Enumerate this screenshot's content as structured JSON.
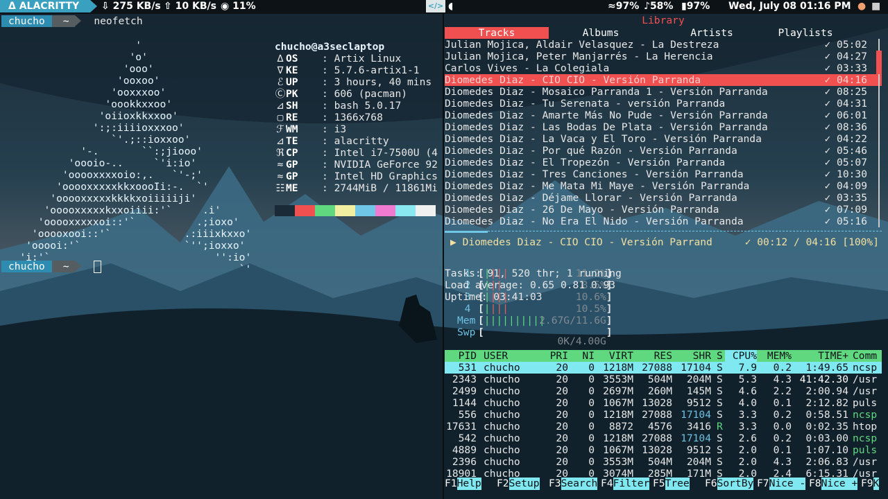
{
  "topbar": {
    "workspace": "ALACRITTY",
    "net_down": "275 KB/s",
    "net_up": "10 KB/s",
    "cpu": "11%",
    "wifi": "97%",
    "volume": "58%",
    "battery": "97%",
    "datetime": "Wed, July 08 01:16 PM"
  },
  "left_terminal": {
    "prompt_user": "chucho",
    "prompt_dir": "~",
    "command": "neofetch",
    "logo_lines": [
      "                      '",
      "                     'o'",
      "                    'ooo'",
      "                   'ooxoo'",
      "                  'ooxxxoo'",
      "                 'oookkxxoo'",
      "                'oiioxkkxxoo'",
      "               ':;:iiiioxxxoo'",
      "                  `'.;::ioxxoo'",
      "             '-.       ``:;jiooo'",
      "           'oooio-..     `'i:io'",
      "          'ooooxxxxoio:,.   `'-;'",
      "         'ooooxxxxxkkxoooIi:-.  `'",
      "        'ooooxxxxxkkkkxoiiiiiji'",
      "       'ooooxxxxxkxxoiiii:'`     .i'",
      "      'ooooxxxxxoi::'`          .;ioxo'",
      "     'ooooxooi::'`            .:iiixkxxo'",
      "    'ooooi:'`                 `'';ioxxo'",
      "   'i:'`                           '':io'",
      "  '`                                   `'"
    ],
    "info_header": "chucho@a3seclaptop",
    "info": [
      {
        "key": "OS",
        "value": "Artix Linux"
      },
      {
        "key": "KE",
        "value": "5.7.6-artix1-1"
      },
      {
        "key": "UP",
        "value": "3 hours, 40 mins"
      },
      {
        "key": "PK",
        "value": "606 (pacman)"
      },
      {
        "key": "SH",
        "value": "bash 5.0.17"
      },
      {
        "key": "RE",
        "value": "1366x768"
      },
      {
        "key": "WM",
        "value": "i3"
      },
      {
        "key": "TE",
        "value": "alacritty"
      },
      {
        "key": "CP",
        "value": "Intel i7-7500U (4"
      },
      {
        "key": "GP",
        "value": "NVIDIA GeForce 92"
      },
      {
        "key": "GP",
        "value": "Intel HD Graphics"
      },
      {
        "key": "ME",
        "value": "2744MiB / 11861Mi"
      }
    ],
    "swatch_colors": [
      "#1a2a36",
      "#f05050",
      "#5fd87f",
      "#f2f0a0",
      "#6fc6e6",
      "#f07ad0",
      "#8ae8f0",
      "#f0f0f0"
    ],
    "prompt2_user": "chucho",
    "prompt2_dir": "~"
  },
  "music": {
    "title": "Library",
    "tabs": [
      "Tracks",
      "Albums",
      "Artists",
      "Playlists"
    ],
    "tracks": [
      {
        "name": "Julian Mojica, Aldair Velasquez - La Destreza",
        "dur": "✓ 05:02"
      },
      {
        "name": "Julian Mojica, Peter Manjarrés - La Herencia",
        "dur": "✓ 04:27"
      },
      {
        "name": "Carlos Vives - La Colegiala",
        "dur": "✓ 03:33"
      },
      {
        "name": "Diomedes Diaz - CIO CIO - Versión Parranda",
        "dur": "✓ 04:16"
      },
      {
        "name": "Diomedes Diaz - Mosaico Parranda 1 - Versión Parranda",
        "dur": "✓ 08:25"
      },
      {
        "name": "Diomedes Diaz - Tu Serenata - versión Parranda",
        "dur": "✓ 04:31"
      },
      {
        "name": "Diomedes Diaz - Amarte Más No Pude - Versión Parranda",
        "dur": "✓ 06:01"
      },
      {
        "name": "Diomedes Diaz - Las Bodas De Plata - Versión Parranda",
        "dur": "✓ 08:36"
      },
      {
        "name": "Diomedes Diaz - La Vaca y El Toro - Versión Parranda",
        "dur": "✓ 04:22"
      },
      {
        "name": "Diomedes Diaz - Por qué Razón - Versión Parranda",
        "dur": "✓ 05:46"
      },
      {
        "name": "Diomedes Diaz - El Tropezón - Versión Parranda",
        "dur": "✓ 05:07"
      },
      {
        "name": "Diomedes Diaz - Tres Canciones - Versión Parranda",
        "dur": "✓ 10:30"
      },
      {
        "name": "Diomedes Diaz - Me Mata Mi Maye - Versión Parranda",
        "dur": "✓ 04:09"
      },
      {
        "name": "Diomedes Diaz - Déjame Llorar - Versión Parranda",
        "dur": "✓ 03:35"
      },
      {
        "name": "Diomedes Diaz - 26 De Mayo - Versión Parranda",
        "dur": "✓ 07:09"
      },
      {
        "name": "Diomedes Diaz - No Era El Nido - Versión Parranda",
        "dur": "✓ 05:16"
      }
    ],
    "selected_track": 3,
    "now_playing": "▶  Diomedes Diaz - CIO CIO - Versión Parrand",
    "now_time": "✓ 00:12 / 04:16 [100%]",
    "progress_fraction": 0.047
  },
  "htop": {
    "meters": [
      {
        "label": "1",
        "value": "11.2%"
      },
      {
        "label": "2",
        "value": "8.5%"
      },
      {
        "label": "3",
        "value": "10.6%"
      },
      {
        "label": "4",
        "value": "10.5%"
      },
      {
        "label": "Mem",
        "value": "2.67G/11.6G"
      },
      {
        "label": "Swp",
        "value": "0K/4.00G"
      }
    ],
    "tasks_label": "Tasks: ",
    "tasks": "91",
    "thr": "520",
    "thr_label": " thr; ",
    "running": "1",
    "running_label": " running",
    "load_label": "Load average: ",
    "load1": "0.65",
    "load5": "0.81",
    "load15": "0.93",
    "uptime_label": "Uptime: ",
    "uptime": "03:41:03",
    "columns": [
      "PID",
      "USER",
      "PRI",
      "NI",
      "VIRT",
      "RES",
      "SHR",
      "S",
      "CPU%",
      "MEM%",
      "TIME+",
      "Comm"
    ],
    "rows": [
      [
        "531",
        "chucho",
        "20",
        "0",
        "1218M",
        "27088",
        "17104",
        "S",
        "7.9",
        "0.2",
        "1:49.65",
        "ncsp"
      ],
      [
        "2343",
        "chucho",
        "20",
        "0",
        "3553M",
        "504M",
        "204M",
        "S",
        "5.3",
        "4.3",
        "41:42.30",
        "/usr"
      ],
      [
        "2499",
        "chucho",
        "20",
        "0",
        "2697M",
        "260M",
        "145M",
        "S",
        "4.6",
        "2.2",
        "2:00.94",
        "/usr"
      ],
      [
        "1144",
        "chucho",
        "20",
        "0",
        "1067M",
        "13028",
        "9512",
        "S",
        "4.0",
        "0.1",
        "2:12.82",
        "puls"
      ],
      [
        "556",
        "chucho",
        "20",
        "0",
        "1218M",
        "27088",
        "17104",
        "S",
        "3.3",
        "0.2",
        "0:58.51",
        "ncsp"
      ],
      [
        "17631",
        "chucho",
        "20",
        "0",
        "8872",
        "4576",
        "3416",
        "R",
        "3.3",
        "0.0",
        "0:02.35",
        "htop"
      ],
      [
        "542",
        "chucho",
        "20",
        "0",
        "1218M",
        "27088",
        "17104",
        "S",
        "2.6",
        "0.2",
        "0:03.00",
        "ncsp"
      ],
      [
        "4889",
        "chucho",
        "20",
        "0",
        "1067M",
        "13028",
        "9512",
        "S",
        "2.0",
        "0.1",
        "1:07.10",
        "puls"
      ],
      [
        "2396",
        "chucho",
        "20",
        "0",
        "3553M",
        "504M",
        "204M",
        "S",
        "2.0",
        "4.3",
        "2:06.83",
        "/usr"
      ],
      [
        "18901",
        "chucho",
        "20",
        "0",
        "3074M",
        "285M",
        "171M",
        "S",
        "2.0",
        "2.4",
        "6:15.31",
        "/usr"
      ]
    ],
    "fkeys": [
      {
        "n": "F1",
        "l": "Help  "
      },
      {
        "n": "F2",
        "l": "Setup "
      },
      {
        "n": "F3",
        "l": "Search"
      },
      {
        "n": "F4",
        "l": "Filter"
      },
      {
        "n": "F5",
        "l": "Tree  "
      },
      {
        "n": "F6",
        "l": "SortBy"
      },
      {
        "n": "F7",
        "l": "Nice -"
      },
      {
        "n": "F8",
        "l": "Nice +"
      },
      {
        "n": "F9",
        "l": "K"
      }
    ]
  }
}
